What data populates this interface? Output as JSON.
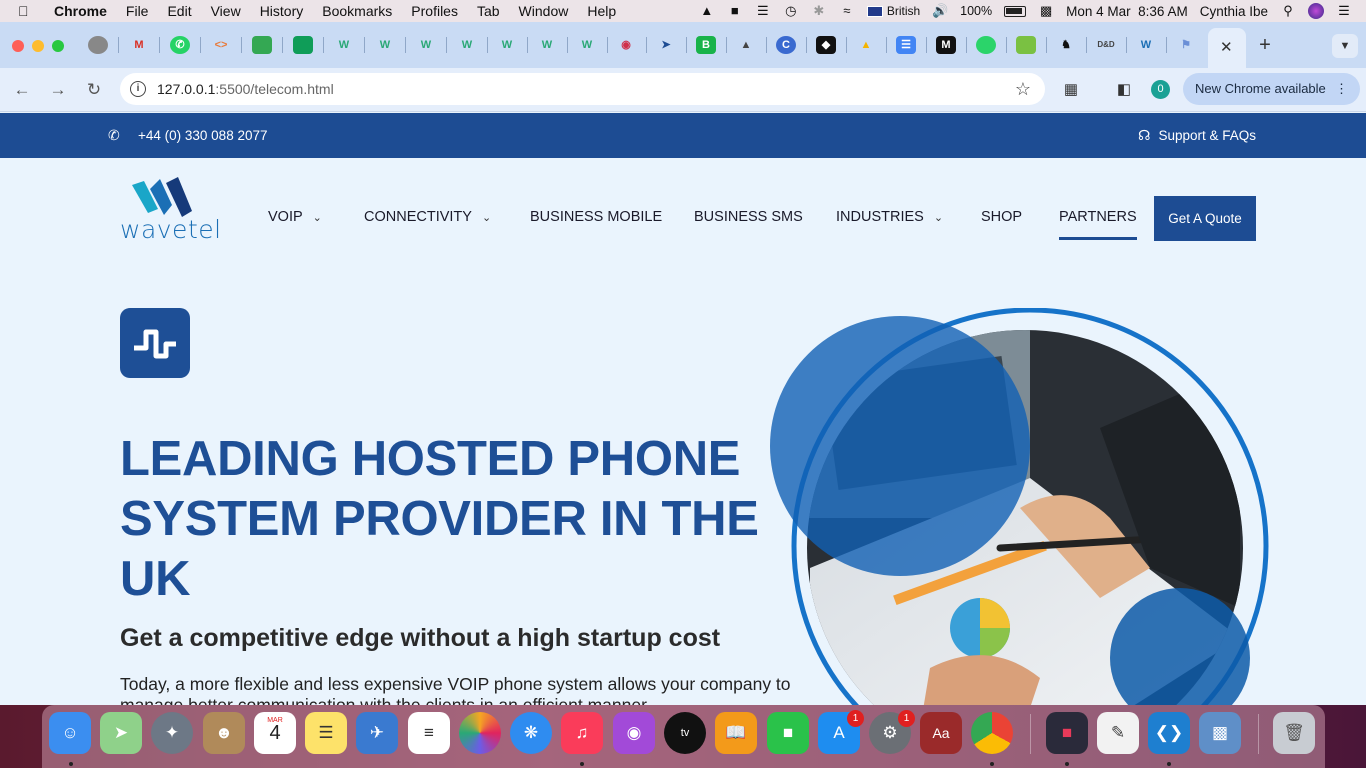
{
  "menubar": {
    "app_name": "Chrome",
    "menus": [
      "File",
      "Edit",
      "View",
      "History",
      "Bookmarks",
      "Profiles",
      "Tab",
      "Window",
      "Help"
    ],
    "keyboard": "British",
    "battery": "100%",
    "datetime": "Mon 4 Mar  8:36 AM",
    "user": "Cynthia Ibe"
  },
  "browser": {
    "url_host": "127.0.0.1",
    "url_path": ":5500/telecom.html",
    "profile_badge": "0",
    "update_label": "New Chrome available"
  },
  "topbar": {
    "phone": "+44 (0) 330 088 2077",
    "support": "Support & FAQs"
  },
  "logo": {
    "text": "wavetel"
  },
  "nav": {
    "voip": "VOIP",
    "connectivity": "CONNECTIVITY",
    "business_mobile": "BUSINESS MOBILE",
    "business_sms": "BUSINESS SMS",
    "industries": "INDUSTRIES",
    "shop": "SHOP",
    "partners": "PARTNERS",
    "quote": "Get A Quote"
  },
  "hero": {
    "title": "LEADING HOSTED PHONE SYSTEM PROVIDER IN THE UK",
    "subtitle": "Get a competitive edge without a high startup cost",
    "body": "Today, a more flexible and less expensive VOIP phone system allows your company to manage better communication with the clients in an efficient manner."
  },
  "dock": {
    "calendar_month": "MAR",
    "calendar_day": "4",
    "appstore_badge": "1",
    "settings_badge": "1"
  },
  "colors": {
    "brand_blue": "#1d4c93",
    "page_bg": "#eaf4fd",
    "accent_cyan": "#1b6fb5"
  }
}
